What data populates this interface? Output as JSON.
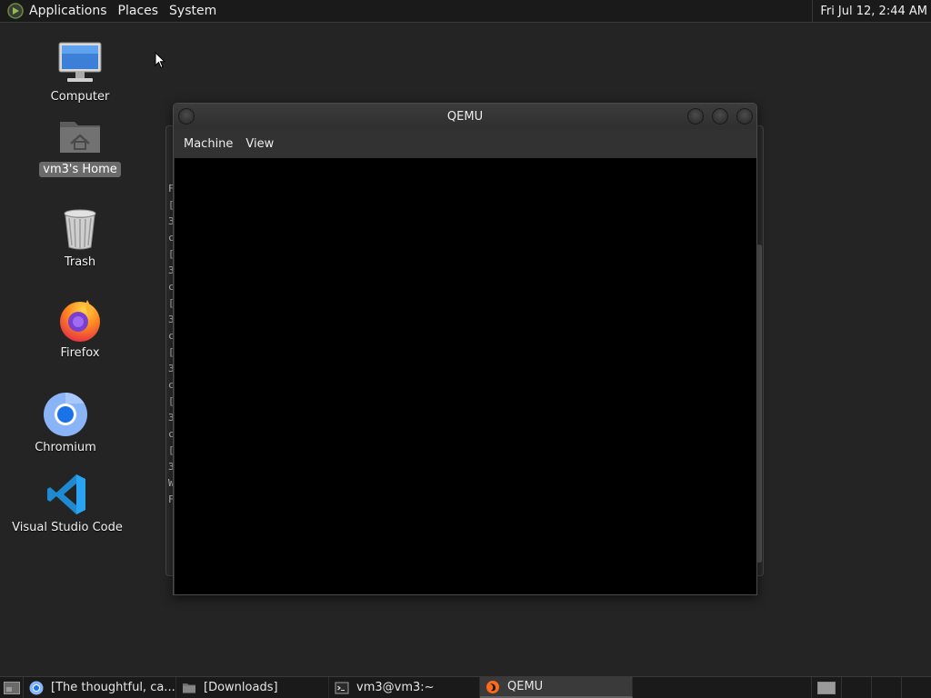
{
  "top_panel": {
    "applications_label": "Applications",
    "places_label": "Places",
    "system_label": "System",
    "clock": "Fri Jul 12,  2:44 AM"
  },
  "desktop": {
    "icons": [
      {
        "label": "Computer",
        "icon": "computer-icon"
      },
      {
        "label": "vm3's Home",
        "icon": "home-folder-icon",
        "selected": true
      },
      {
        "label": "Trash",
        "icon": "trash-icon"
      },
      {
        "label": "Firefox",
        "icon": "firefox-icon"
      },
      {
        "label": "Chromium",
        "icon": "chromium-icon"
      },
      {
        "label": "Visual Studio Code",
        "icon": "vscode-icon"
      }
    ]
  },
  "qemu_window": {
    "title": "QEMU",
    "menu": [
      "Machine",
      "View"
    ]
  },
  "background_terminal": {
    "visible_chars": [
      "F",
      "[",
      "3",
      "c",
      "[",
      "3",
      "c",
      "[",
      "3",
      "c",
      "[",
      "3",
      "c",
      "[",
      "3",
      "c",
      "[",
      "3",
      "W",
      "",
      "F"
    ]
  },
  "taskbar": {
    "tasks": [
      {
        "label": "[The thoughtful, ca...",
        "icon": "chromium-icon",
        "active": false
      },
      {
        "label": "[Downloads]",
        "icon": "folder-icon",
        "active": false
      },
      {
        "label": "vm3@vm3:~",
        "icon": "terminal-icon",
        "active": false
      },
      {
        "label": "QEMU",
        "icon": "qemu-icon",
        "active": true
      }
    ],
    "workspaces": 4
  },
  "colors": {
    "desktop_bg": "#242424",
    "panel_bg": "#1a1a1a",
    "vm_screen": "#000000",
    "selection": "#6b6b6b"
  }
}
